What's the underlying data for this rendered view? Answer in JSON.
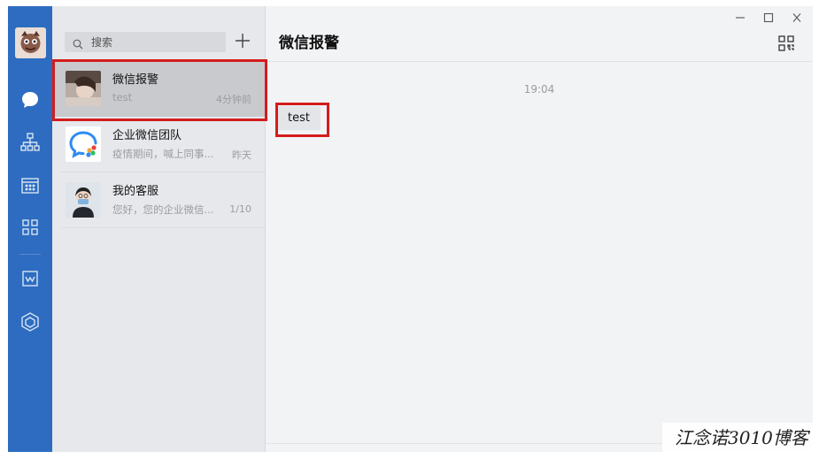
{
  "sidebar": {
    "icons": [
      "chat-icon",
      "contacts-icon",
      "calendar-icon",
      "apps-icon",
      "docs-icon",
      "workbench-icon"
    ],
    "accent": "#2d6cc0"
  },
  "search": {
    "placeholder": "搜索"
  },
  "conversations": [
    {
      "name": "微信报警",
      "preview": "test",
      "time": "4分钟前",
      "selected": true
    },
    {
      "name": "企业微信团队",
      "preview": "疫情期间，喊上同事...",
      "time": "昨天"
    },
    {
      "name": "我的客服",
      "preview": "您好，您的企业微信...",
      "time": "1/10"
    }
  ],
  "chat": {
    "title": "微信报警",
    "messages": [
      {
        "timestamp": "19:04",
        "text": "test"
      }
    ]
  },
  "watermark": "江念诺3010博客"
}
